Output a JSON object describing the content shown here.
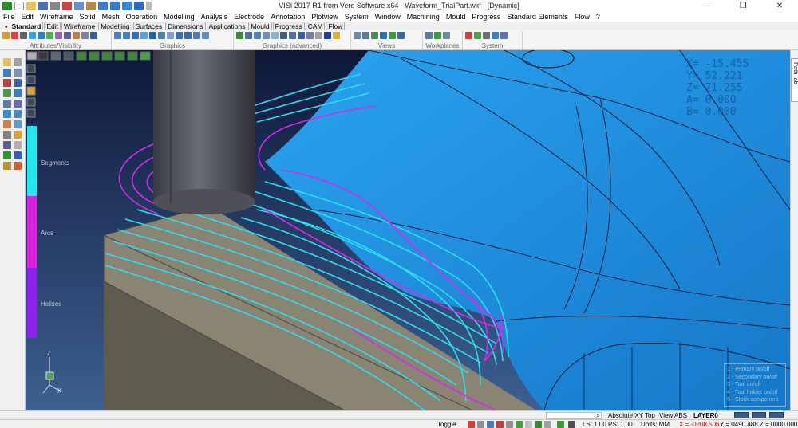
{
  "window": {
    "title": "VISI 2017 R1   from Vero Software x64 - Waveform_TrialPart.wkf - [Dynamic]",
    "controls": [
      "—",
      "❐",
      "✕"
    ]
  },
  "quick_access_icons": [
    "visi-logo-icon",
    "new-file-icon",
    "open-file-icon",
    "save-icon",
    "print-icon",
    "cut-icon",
    "copy-icon",
    "paste-icon",
    "undo-icon",
    "redo-icon",
    "pointer-icon",
    "help-icon",
    "dropdown-icon"
  ],
  "menu": [
    "File",
    "Edit",
    "Wireframe",
    "Solid",
    "Mesh",
    "Operation",
    "Modelling",
    "Analysis",
    "Electrode",
    "Annotation",
    "Plotview",
    "System",
    "Window",
    "Machining",
    "Mould",
    "Progress",
    "Standard Elements",
    "Flow",
    "?"
  ],
  "ribbon_tabs": [
    "Standard",
    "Edit",
    "Wireframe",
    "Modelling",
    "Surfaces",
    "Dimensions",
    "Applications",
    "Mould",
    "Progress",
    "CAM",
    "Flow"
  ],
  "toolbar_groups": [
    {
      "label": "Attributes/Visibility"
    },
    {
      "label": "Graphics"
    },
    {
      "label": "Graphics (advanced)"
    },
    {
      "label": "Views"
    },
    {
      "label": "Workplanes"
    },
    {
      "label": "System"
    }
  ],
  "viewport": {
    "coords": [
      "X= -15.455",
      "Y=   52.221",
      "Z=   71.255",
      "A=    0.000",
      "B=    0.000"
    ],
    "legend": [
      {
        "label": "Segments",
        "color": "#20e8f0"
      },
      {
        "label": "Arcs",
        "color": "#e020e0"
      },
      {
        "label": "Helixes",
        "color": "#9020f0"
      }
    ],
    "layer_items": [
      "1 - Primary on/off",
      "2 - Secondary on/off",
      "3 - Tool on/off",
      "4 - Tool holder on/off",
      "5 - Stock component"
    ],
    "axis_labels": {
      "z": "Z",
      "x": "X"
    },
    "colors": {
      "background_top": "#0e1738",
      "background_bottom": "#3c6090",
      "part_surface": "#1c8ee0",
      "toolpath_segments": "#28e0f0",
      "toolpath_arcs": "#d828f0",
      "stock": "#8a8472",
      "tool": "#55565e"
    }
  },
  "right_panel": {
    "tab": "Path-lab"
  },
  "status_top": {
    "view": "Absolute XY Top",
    "view_abs": "View ABS",
    "layer": "LAYER0"
  },
  "status_bottom": {
    "toggle": "Toggle",
    "ls_ps": "LS: 1.00 PS: 1.00",
    "units": "Units: MM",
    "x": "X = -0208.506",
    "y": "Y = 0490.488",
    "z": "Z = 0000.000"
  }
}
